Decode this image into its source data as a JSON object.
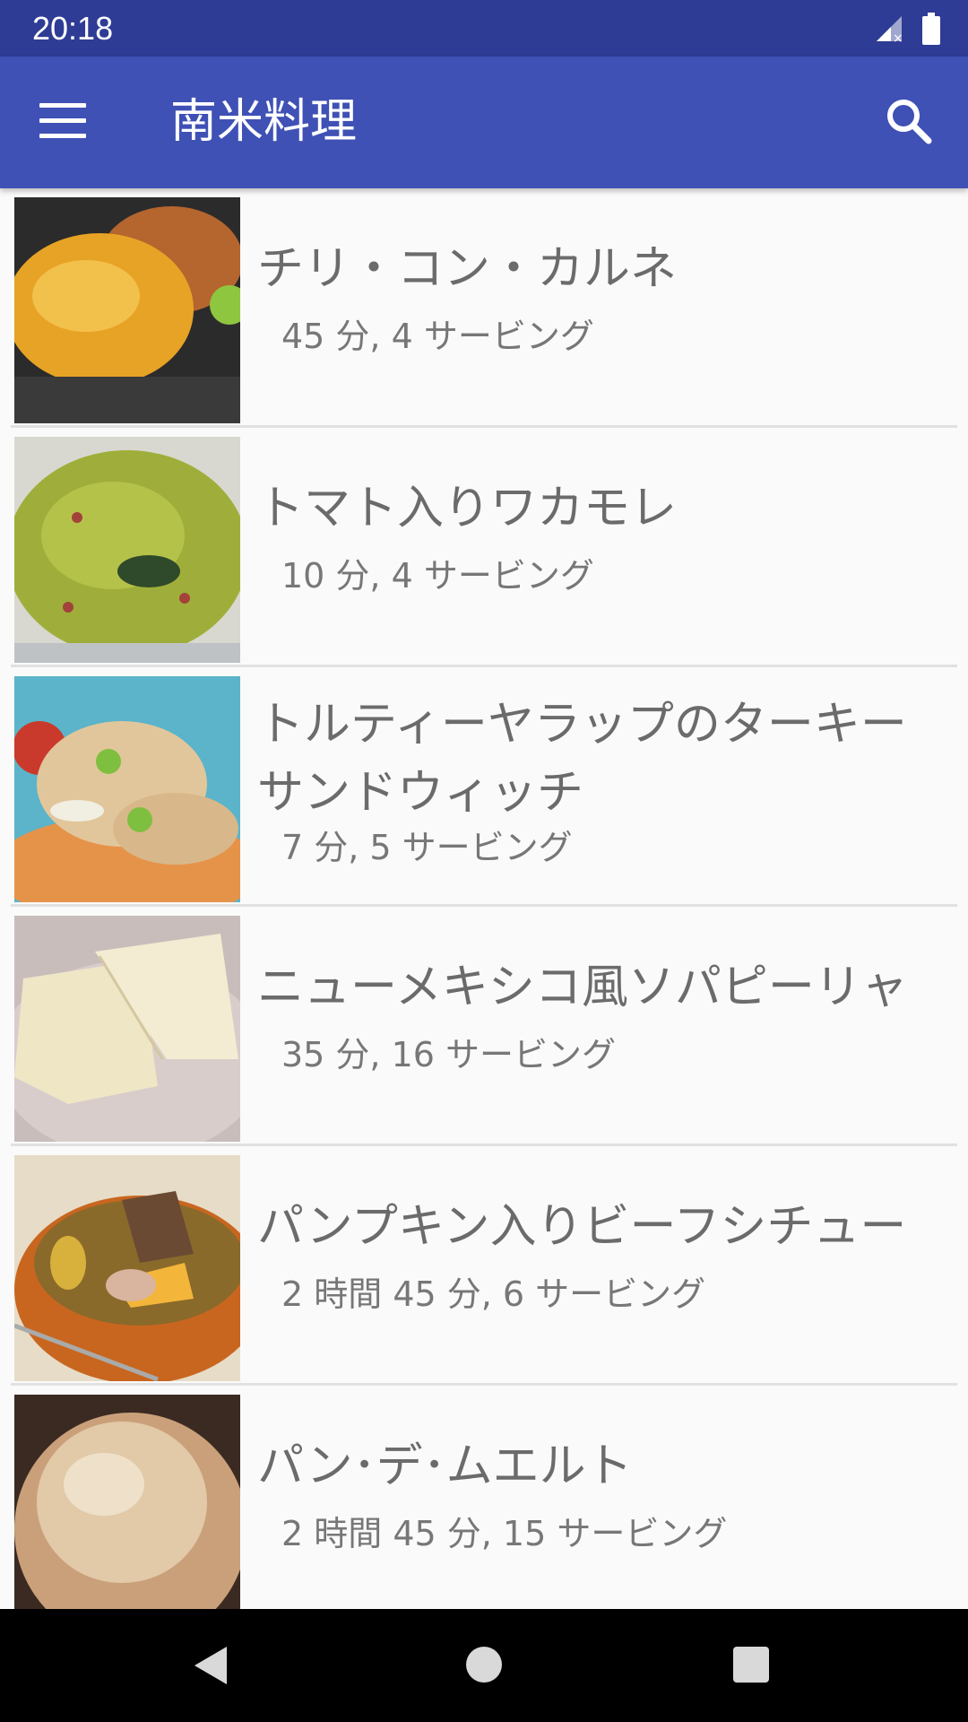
{
  "status_bar": {
    "time": "20:18"
  },
  "app_bar": {
    "title": "南米料理"
  },
  "recipes": [
    {
      "title": "チリ・コン・カルネ",
      "subtitle": "45 分, 4 サービング"
    },
    {
      "title": "トマト入りワカモレ",
      "subtitle": "10 分, 4 サービング"
    },
    {
      "title": "トルティーヤラップのターキーサンドウィッチ",
      "subtitle": "7 分, 5 サービング"
    },
    {
      "title": "ニューメキシコ風ソパピーリャ",
      "subtitle": "35 分, 16 サービング"
    },
    {
      "title": "パンプキン入りビーフシチュー",
      "subtitle": "2 時間 45 分, 6 サービング"
    },
    {
      "title": "パン･デ･ムエルト",
      "subtitle": "2 時間 45 分, 15 サービング"
    }
  ]
}
